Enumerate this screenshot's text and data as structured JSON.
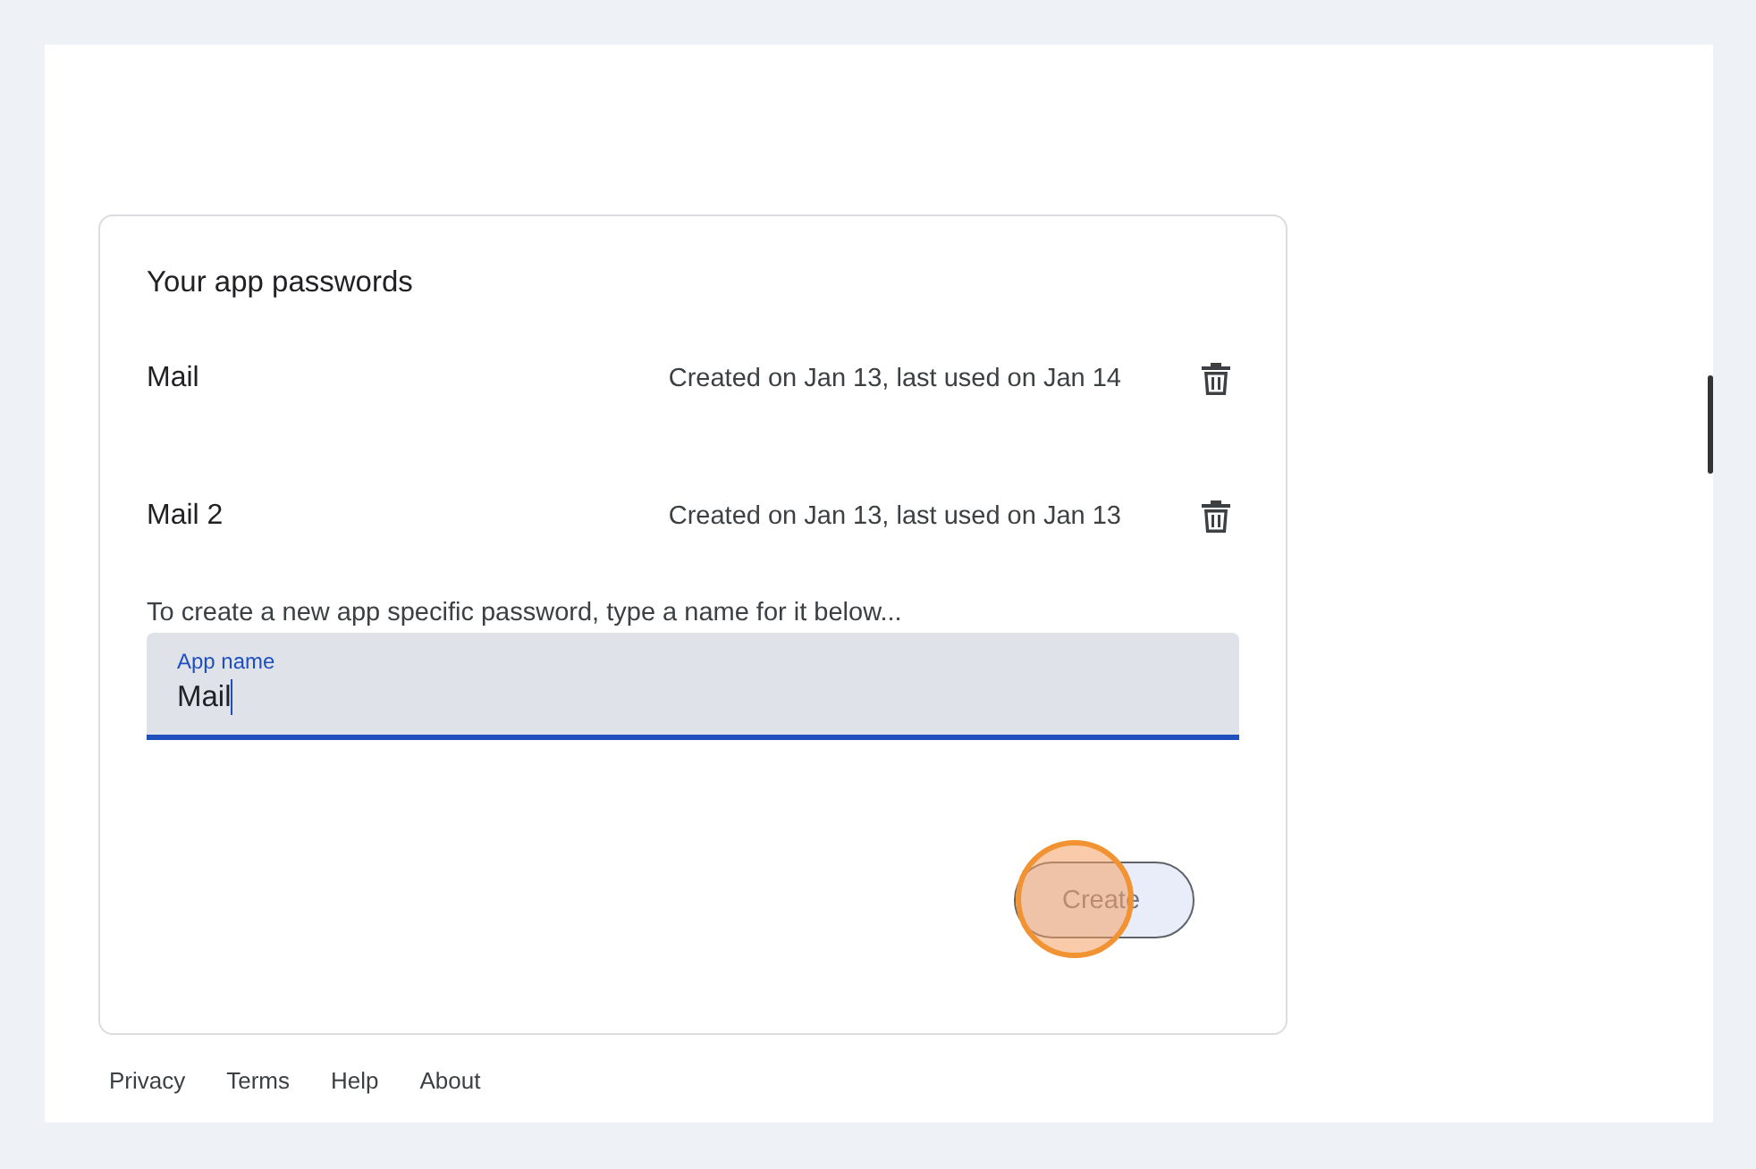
{
  "card": {
    "title": "Your app passwords",
    "passwords": [
      {
        "name": "Mail",
        "info": "Created on Jan 13, last used on Jan 14"
      },
      {
        "name": "Mail 2",
        "info": "Created on Jan 13, last used on Jan 13"
      }
    ],
    "hint": "To create a new app specific password, type a name for it below...",
    "field": {
      "label": "App name",
      "value": "Mail",
      "focused": true
    },
    "button": "Create"
  },
  "footer": [
    "Privacy",
    "Terms",
    "Help",
    "About"
  ]
}
